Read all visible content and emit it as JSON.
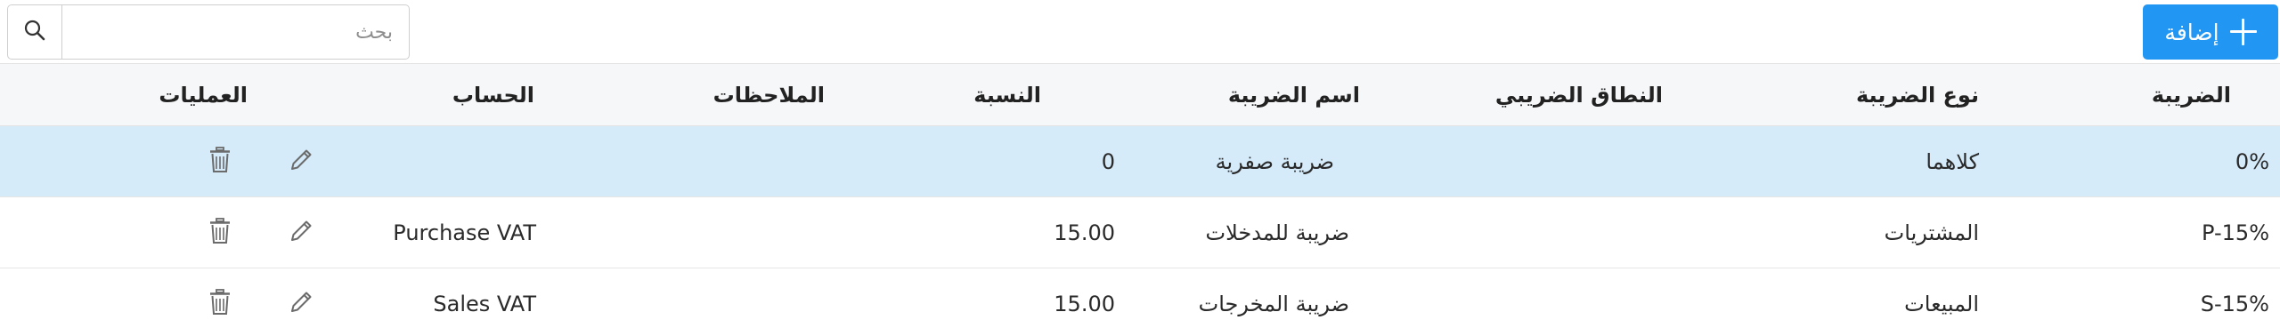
{
  "toolbar": {
    "add_label": "إضافة",
    "search_placeholder": "بحث",
    "search_value": ""
  },
  "colors": {
    "accent": "#2196f3",
    "header_bg": "#f6f7f9",
    "selected_row_bg": "#d5ebfa"
  },
  "icons": {
    "add": "plus-icon",
    "search": "search-icon",
    "edit": "pencil-icon",
    "delete": "trash-icon"
  },
  "table": {
    "headers": {
      "tax": "الضريبة",
      "tax_type": "نوع الضريبة",
      "tax_scope": "النطاق الضريبي",
      "tax_name": "اسم الضريبة",
      "rate": "النسبة",
      "notes": "الملاحظات",
      "account": "الحساب",
      "actions": "العمليات"
    },
    "rows": [
      {
        "tax": "0%",
        "tax_type": "كلاهما",
        "tax_scope": "",
        "tax_name": "ضريبة صفرية",
        "rate": "0",
        "notes": "",
        "account": "",
        "selected": true
      },
      {
        "tax": "P-15%",
        "tax_type": "المشتريات",
        "tax_scope": "",
        "tax_name": "ضريبة للمدخلات",
        "rate": "15.00",
        "notes": "",
        "account": "Purchase VAT",
        "selected": false
      },
      {
        "tax": "S-15%",
        "tax_type": "المبيعات",
        "tax_scope": "",
        "tax_name": "ضريبة المخرجات",
        "rate": "15.00",
        "notes": "",
        "account": "Sales VAT",
        "selected": false
      }
    ]
  }
}
